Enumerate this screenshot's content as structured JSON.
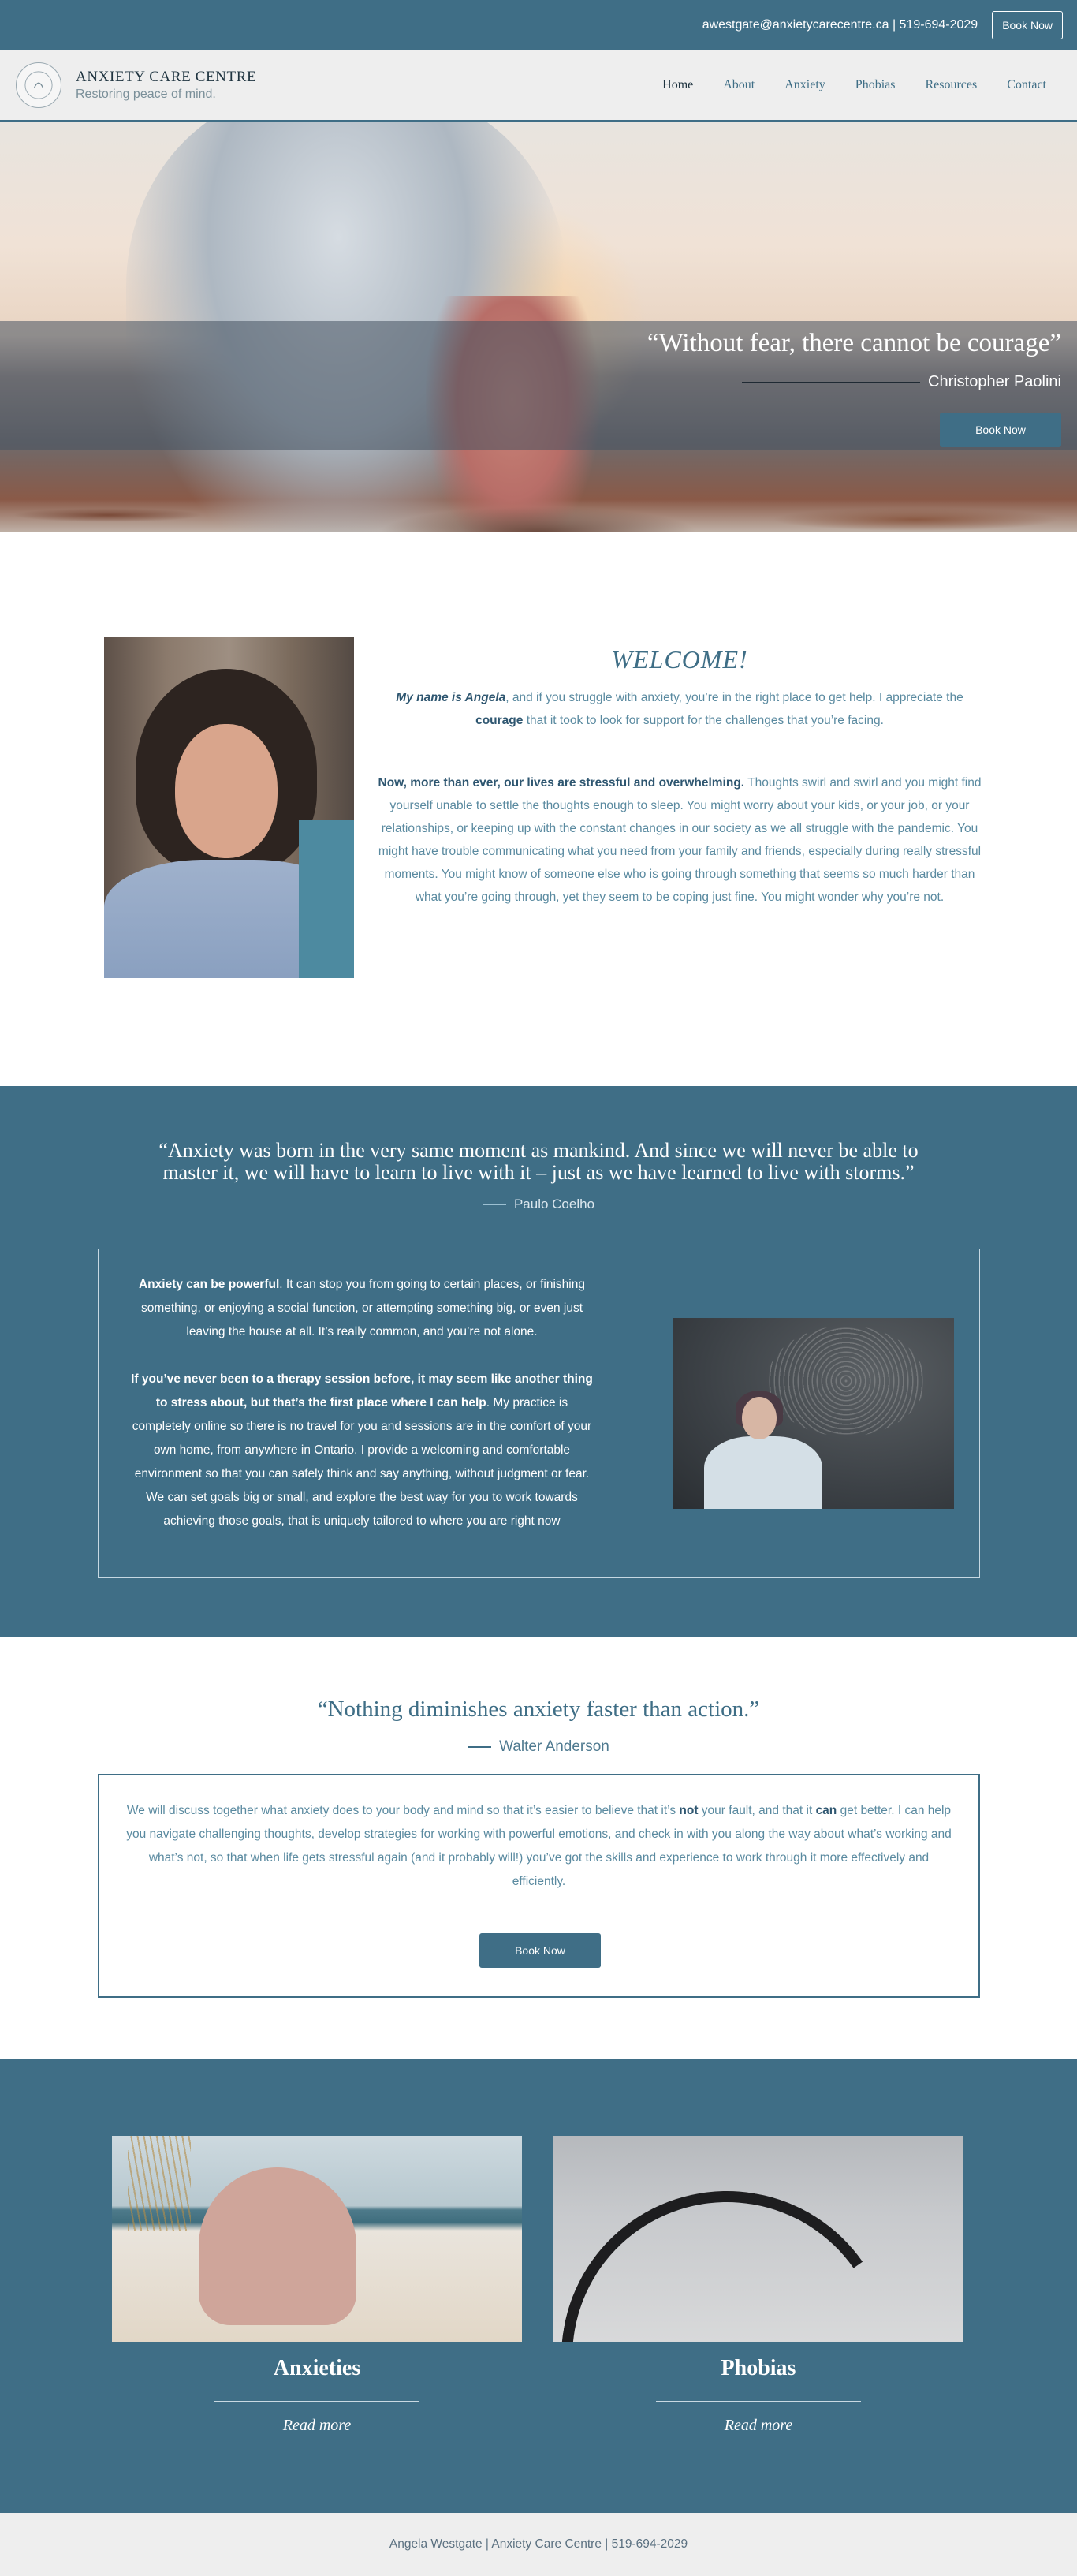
{
  "topbar": {
    "contact": "awestgate@anxietycarecentre.ca | 519-694-2029",
    "book_now": "Book Now"
  },
  "header": {
    "title": "ANXIETY CARE CENTRE",
    "subtitle": "Restoring peace of mind.",
    "nav": [
      {
        "label": "Home"
      },
      {
        "label": "About"
      },
      {
        "label": "Anxiety"
      },
      {
        "label": "Phobias"
      },
      {
        "label": "Resources"
      },
      {
        "label": "Contact"
      }
    ]
  },
  "hero": {
    "quote": "“Without fear, there cannot be courage”",
    "attribution": "Christopher Paolini",
    "button": "Book Now"
  },
  "welcome": {
    "title": "WELCOME!",
    "p1_bold_italic": "My name is Angela",
    "p1_a": ", and if you struggle with anxiety, you’re in the right place to get help. I appreciate the ",
    "p1_bold": "courage",
    "p1_b": " that it took to look for support for the challenges that you’re facing.",
    "p2_bold": "Now, more than ever, our lives are stressful and overwhelming.",
    "p2_text": " Thoughts swirl and swirl and you might find yourself unable to settle the thoughts enough to sleep. You might worry about your kids, or your job, or your relationships, or keeping up with the constant changes in our society as we all struggle with the pandemic. You might have trouble communicating what you need from your family and friends, especially during really stressful moments. You might know of someone else who is going through something that seems so much harder than what you’re going through, yet they seem to be coping just fine. You might wonder why you’re not."
  },
  "coelho": {
    "quote": "“Anxiety was born in the very same moment as mankind. And since we will never be able to master it, we will have to learn to live with it – just as we have learned to live with storms.”",
    "attribution": "Paulo Coelho",
    "p1_bold": "Anxiety can be powerful",
    "p1_text": ". It can stop you from going to certain places, or finishing something, or enjoying a social function, or attempting something big, or even just leaving the house at all.  It’s really common, and you’re not alone.",
    "p2_bold": "If you’ve never been to a therapy session before, it may seem like another thing to stress about, but that’s the first place where I can help",
    "p2_text": ". My practice is completely online so there is no travel for you and sessions are in the comfort of your own home, from anywhere in Ontario. I provide a welcoming and comfortable environment so that you can safely think and say anything, without judgment or fear. We can set goals big or small, and explore the best way for you to work towards achieving those goals, that is uniquely tailored to where you are right now"
  },
  "action": {
    "quote": "“Nothing diminishes anxiety faster than action.”",
    "attribution": "Walter Anderson",
    "text_a": "We will discuss together what anxiety does to your body and mind so that it’s easier to believe that it’s ",
    "text_not": "not",
    "text_b": " your fault, and that it ",
    "text_can": "can",
    "text_c": " get better. I can help you navigate challenging thoughts, develop strategies for working with powerful emotions, and check in with you along the way about what’s working and what’s not, so that when life gets stressful again (and it probably will!) you’ve got the skills and experience to work through it more effectively and efficiently.",
    "button": "Book Now"
  },
  "cards": [
    {
      "title": "Anxieties",
      "link": "Read more"
    },
    {
      "title": "Phobias",
      "link": "Read more"
    }
  ],
  "footer": {
    "text": "Angela Westgate | Anxiety Care Centre | 519-694-2029"
  },
  "colors": {
    "primary": "#3f6e86",
    "background": "#ffffff",
    "header_bg": "#eeeeee"
  }
}
